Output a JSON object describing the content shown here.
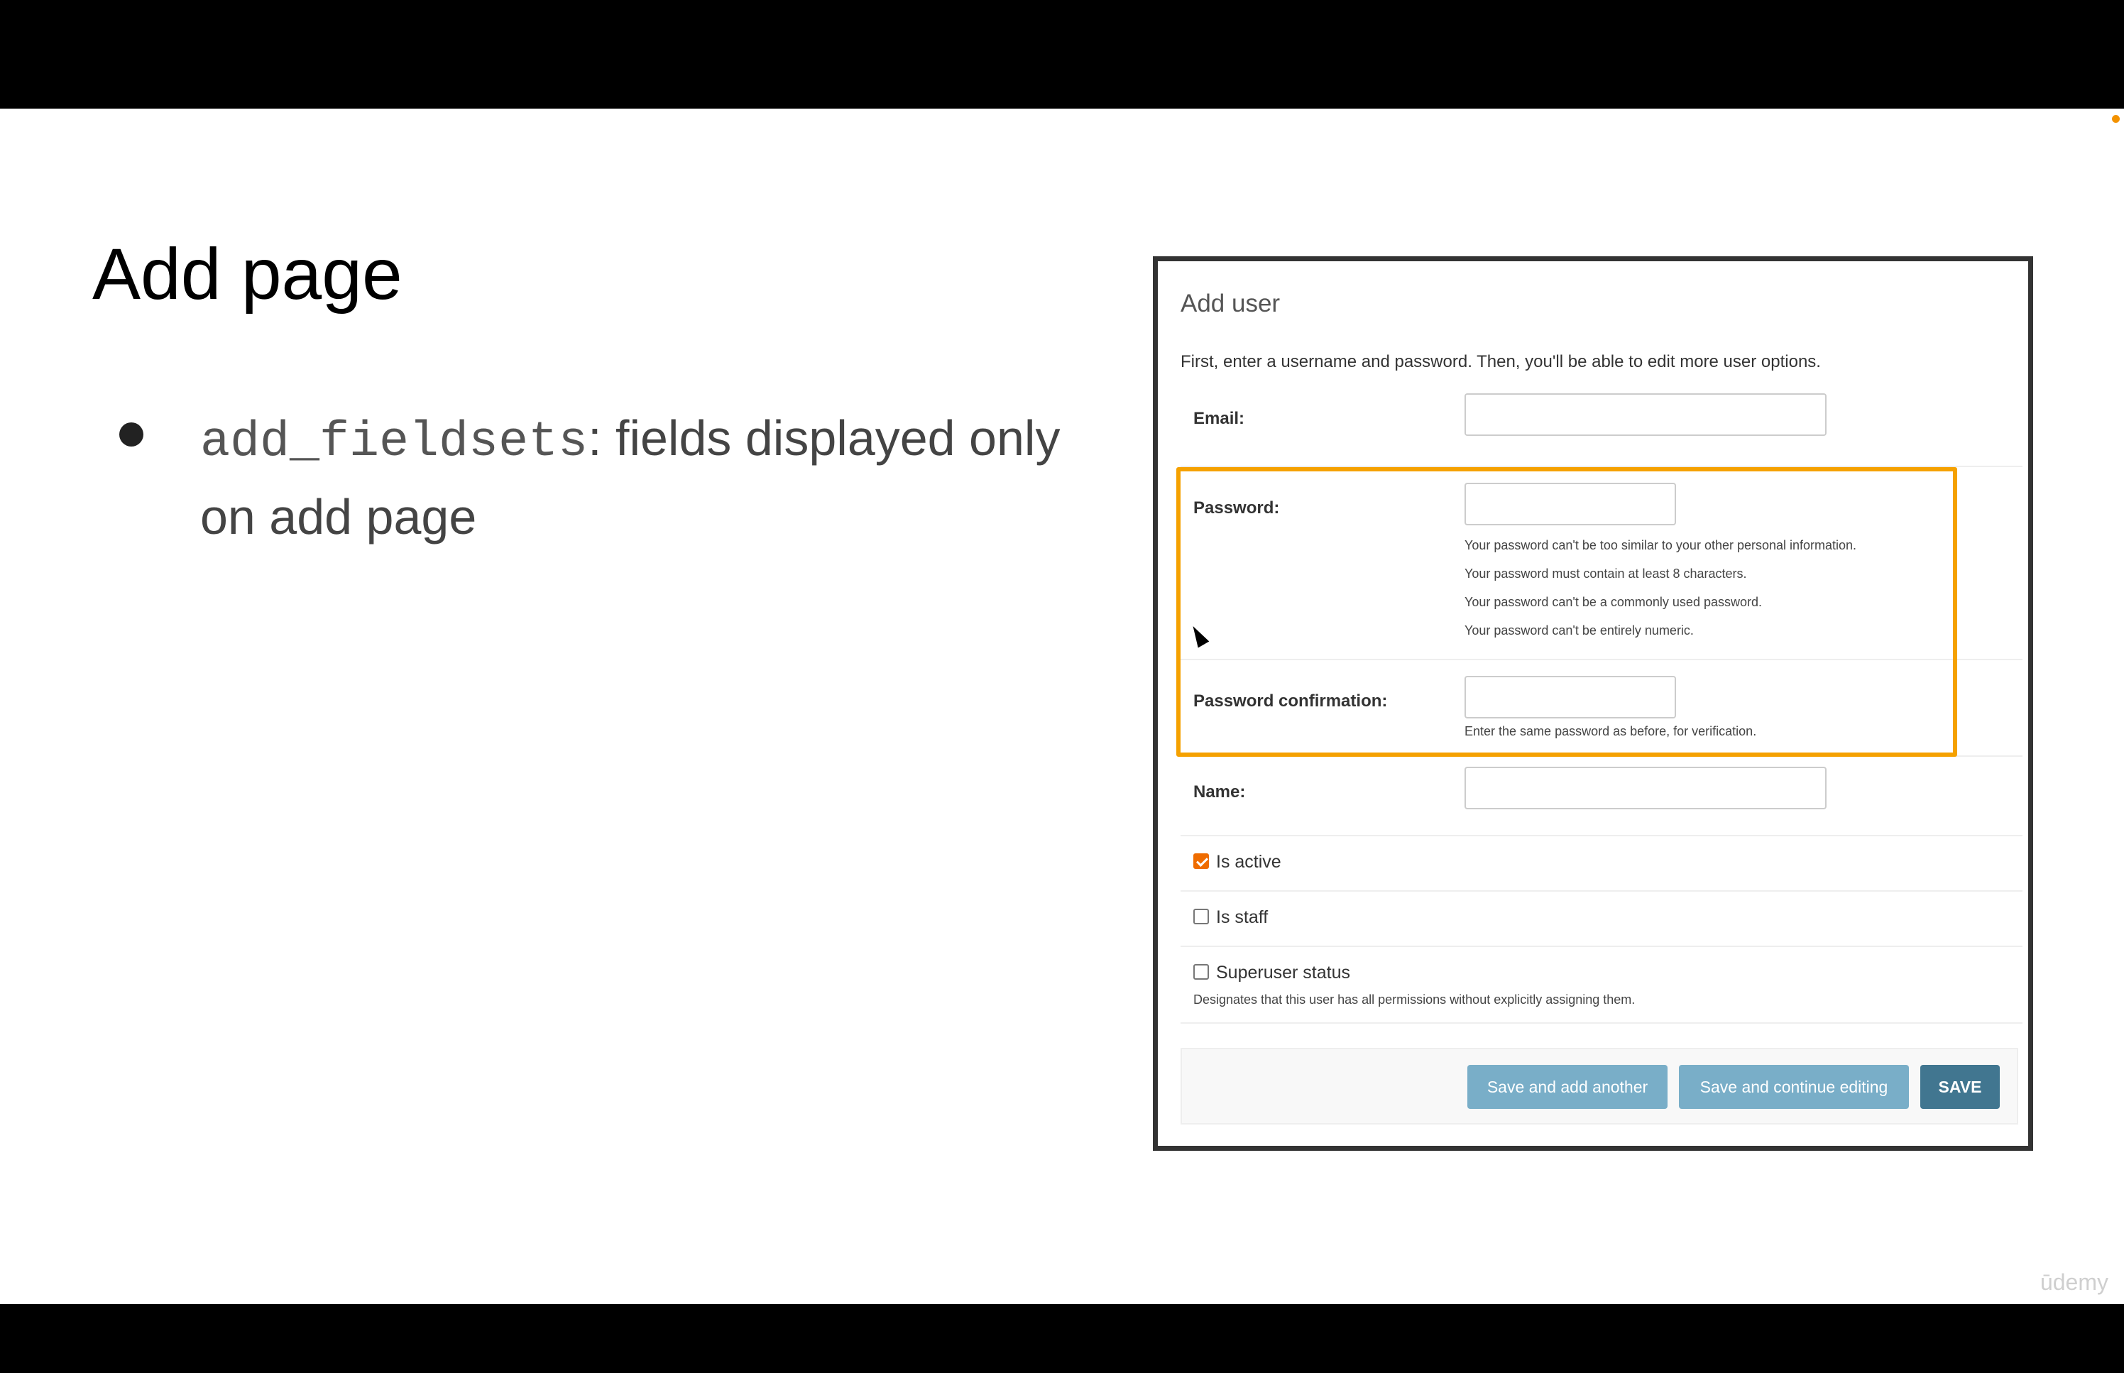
{
  "slide": {
    "title": "Add page",
    "bullet_code": "add_fieldsets",
    "bullet_text": ": fields displayed only on add page",
    "watermark": "ūdemy"
  },
  "form": {
    "title": "Add user",
    "intro": "First, enter a username and password. Then, you'll be able to edit more user options.",
    "email_label": "Email:",
    "password_label": "Password:",
    "password_help": [
      "Your password can't be too similar to your other personal information.",
      "Your password must contain at least 8 characters.",
      "Your password can't be a commonly used password.",
      "Your password can't be entirely numeric."
    ],
    "password_confirmation_label": "Password confirmation:",
    "password_confirmation_help": "Enter the same password as before, for verification.",
    "name_label": "Name:",
    "is_active_label": "Is active",
    "is_active_checked": true,
    "is_staff_label": "Is staff",
    "is_staff_checked": false,
    "superuser_label": "Superuser status",
    "superuser_checked": false,
    "superuser_help": "Designates that this user has all permissions without explicitly assigning them."
  },
  "buttons": {
    "save_add_another": "Save and add another",
    "save_continue": "Save and continue editing",
    "save": "SAVE"
  },
  "colors": {
    "highlight": "#f5a100",
    "button": "#79aec8",
    "save_button": "#417690",
    "checkbox_checked": "#ef6c00"
  }
}
